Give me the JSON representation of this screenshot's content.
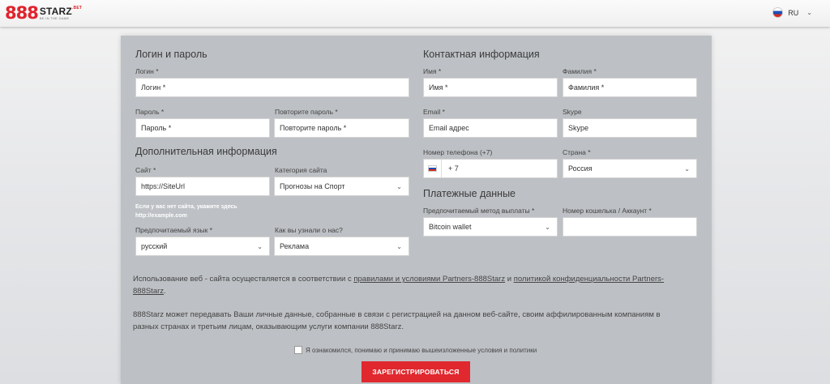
{
  "header": {
    "logo_number": "888",
    "logo_name": "STARZ",
    "logo_suffix": ".BET",
    "logo_tagline": "BE IN THE GAME",
    "language": "RU"
  },
  "form": {
    "login_section": {
      "title": "Логин и пароль",
      "login_label": "Логин *",
      "login_placeholder": "Логин *",
      "password_label": "Пароль *",
      "password_placeholder": "Пароль *",
      "repeat_password_label": "Повторите пароль *",
      "repeat_password_placeholder": "Повторите пароль *"
    },
    "additional_section": {
      "title": "Дополнительная информация",
      "site_label": "Сайт *",
      "site_value": "https://SiteUrl",
      "site_category_label": "Категория сайта",
      "site_category_value": "Прогнозы на Спорт",
      "no_site_note_line1": "Если у вас нет сайта, укажите здесь",
      "no_site_note_line2": "http://example.com",
      "language_label": "Предпочитаемый язык *",
      "language_value": "русский",
      "source_label": "Как вы узнали о нас?",
      "source_value": "Реклама"
    },
    "contact_section": {
      "title": "Контактная информация",
      "first_name_label": "Имя *",
      "first_name_placeholder": "Имя *",
      "last_name_label": "Фамилия *",
      "last_name_placeholder": "Фамилия *",
      "email_label": "Email *",
      "email_placeholder": "Email адрес",
      "skype_label": "Skype",
      "skype_placeholder": "Skype",
      "phone_label": "Номер телефона (+7)",
      "phone_value": "+ 7",
      "country_label": "Страна *",
      "country_value": "Россия"
    },
    "payment_section": {
      "title": "Платежные данные",
      "method_label": "Предпочитаемый метод выплаты *",
      "method_value": "Bitcoin wallet",
      "wallet_label": "Номер кошелька / Аккаунт *",
      "wallet_value": ""
    },
    "terms": {
      "line1_prefix": "Использование веб - сайта осуществляется в соответствии с ",
      "rules_link": "правилами и условиями Partners-888Starz",
      "and": " и ",
      "privacy_link": "политикой конфиденциальности Partners-",
      "line2": "888Starz",
      "line2_suffix": ".",
      "data_para_line1": "888Starz может передавать Ваши личные данные, собранные в связи с регистрацией на данном веб-сайте, своим аффилированным компаниям в",
      "data_para_line2": "разных странах и третьим лицам, оказывающим услуги компании 888Starz.",
      "agree_label": "Я ознакомился, понимаю и принимаю вышеизложенные условия и политики"
    },
    "submit_label": "ЗАРЕГИСТРИРОВАТЬСЯ"
  },
  "colors": {
    "accent": "#e0282e",
    "panel": "#bdc0c4"
  }
}
